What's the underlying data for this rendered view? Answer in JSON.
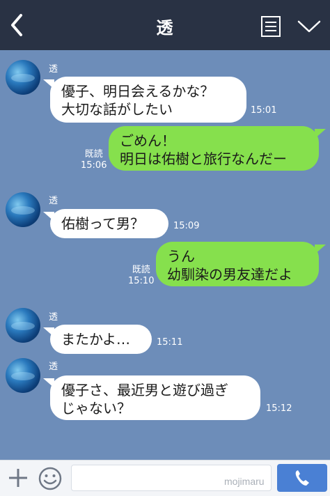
{
  "header": {
    "title": "透",
    "back_icon": "chevron-left-icon",
    "menu_icon": "list-icon",
    "expand_icon": "chevron-down-icon"
  },
  "messages": [
    {
      "side": "left",
      "sender": "透",
      "text": "優子、明日会えるかな？\n大切な話がしたい",
      "time": "15:01"
    },
    {
      "side": "right",
      "read": "既読",
      "text": "ごめん！\n明日は佑樹と旅行なんだー",
      "time": "15:06"
    },
    {
      "side": "left",
      "sender": "透",
      "text": "佑樹って男？",
      "time": "15:09"
    },
    {
      "side": "right",
      "read": "既読",
      "text": "うん\n幼馴染の男友達だよ",
      "time": "15:10"
    },
    {
      "side": "left",
      "sender": "透",
      "text": "またかよ…",
      "time": "15:11"
    },
    {
      "side": "left",
      "sender": "透",
      "text": "優子さ、最近男と遊び過ぎ\nじゃない？",
      "time": "15:12"
    }
  ],
  "input": {
    "placeholder": "",
    "watermark": "mojimaru",
    "plus_icon": "plus-icon",
    "emoji_icon": "smiley-icon",
    "call_icon": "phone-icon"
  },
  "colors": {
    "background": "#6d8db9",
    "header": "#293244",
    "my_bubble": "#86e04d",
    "their_bubble": "#ffffff",
    "call_button": "#4a80d4"
  }
}
